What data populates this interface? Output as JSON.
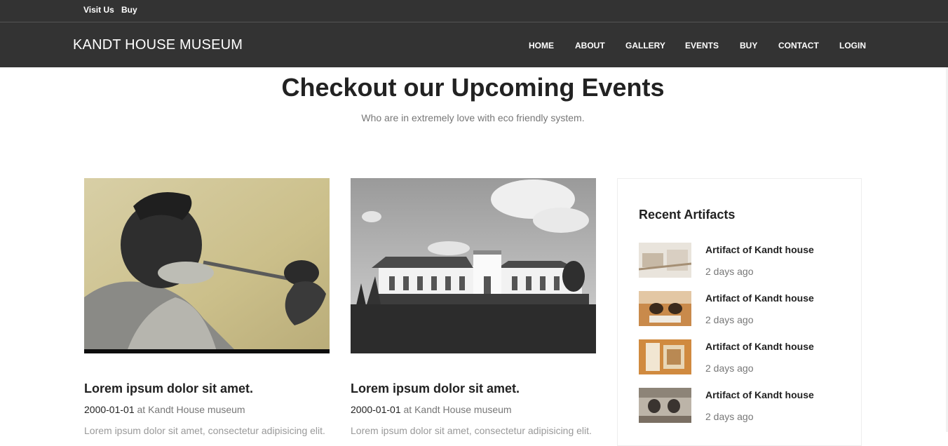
{
  "topbar": {
    "links": [
      "Visit Us",
      "Buy"
    ]
  },
  "navbar": {
    "brand": "KANDT HOUSE MUSEUM",
    "items": [
      "HOME",
      "ABOUT",
      "GALLERY",
      "EVENTS",
      "BUY",
      "CONTACT",
      "LOGIN"
    ]
  },
  "section": {
    "title": "Checkout our Upcoming Events",
    "subtitle": "Who are in extremely love with eco friendly system."
  },
  "events": [
    {
      "title": "Lorem ipsum dolor sit amet.",
      "date": "2000-01-01",
      "location": " at Kandt House museum",
      "excerpt": "Lorem ipsum dolor sit amet, consectetur adipisicing elit."
    },
    {
      "title": "Lorem ipsum dolor sit amet.",
      "date": "2000-01-01",
      "location": " at Kandt House museum",
      "excerpt": "Lorem ipsum dolor sit amet, consectetur adipisicing elit."
    }
  ],
  "sidebar": {
    "title": "Recent Artifacts",
    "items": [
      {
        "name": "Artifact of Kandt house",
        "time": "2 days ago"
      },
      {
        "name": "Artifact of Kandt house",
        "time": "2 days ago"
      },
      {
        "name": "Artifact of Kandt house",
        "time": "2 days ago"
      },
      {
        "name": "Artifact of Kandt house",
        "time": "2 days ago"
      }
    ]
  },
  "colors": {
    "header_bg": "#333333",
    "text_dark": "#222222",
    "text_muted": "#777777"
  }
}
